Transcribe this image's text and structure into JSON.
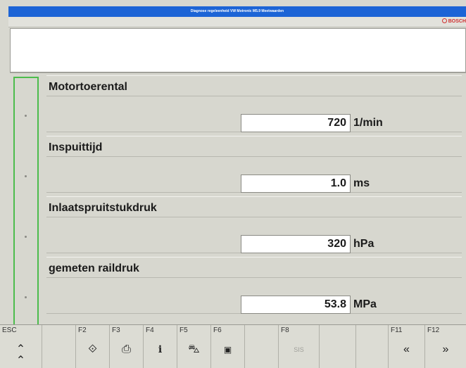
{
  "window": {
    "title": "Diagnose regeleenheid VW Motronic M5.9 Meetwaarden",
    "brand": "BOSCH"
  },
  "values": [
    {
      "label": "Motortoerental",
      "value": "720",
      "unit": "1/min"
    },
    {
      "label": "Inspuittijd",
      "value": "1.0",
      "unit": "ms"
    },
    {
      "label": "Inlaatspruitstukdruk",
      "value": "320",
      "unit": "hPa"
    },
    {
      "label": "gemeten raildruk",
      "value": "53.8",
      "unit": "MPa"
    }
  ],
  "function_keys": [
    {
      "key": "ESC",
      "icon": "double-chevron-up-icon",
      "glyph": "⌃"
    },
    {
      "key": "",
      "icon": "",
      "glyph": ""
    },
    {
      "key": "F2",
      "icon": "arrow-enter-icon",
      "glyph": "⟐"
    },
    {
      "key": "F3",
      "icon": "print-icon",
      "glyph": "⎙"
    },
    {
      "key": "F4",
      "icon": "info-icon",
      "glyph": "i"
    },
    {
      "key": "F5",
      "icon": "car-icon",
      "glyph": "⛍"
    },
    {
      "key": "F6",
      "icon": "screen-icon",
      "glyph": "▣"
    },
    {
      "key": "",
      "icon": "",
      "glyph": ""
    },
    {
      "key": "F8",
      "icon": "sis-icon",
      "glyph": "SIS"
    },
    {
      "key": "",
      "icon": "",
      "glyph": ""
    },
    {
      "key": "",
      "icon": "",
      "glyph": ""
    },
    {
      "key": "F11",
      "icon": "double-chevron-left-icon",
      "glyph": "«"
    },
    {
      "key": "F12",
      "icon": "double-chevron-right-icon",
      "glyph": "»"
    }
  ]
}
